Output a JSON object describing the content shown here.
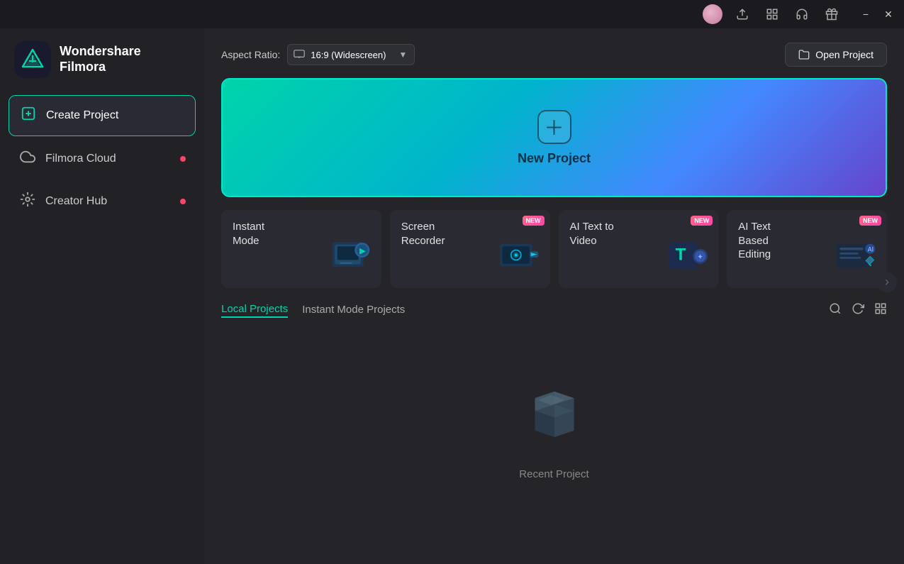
{
  "app": {
    "title": "Wondershare",
    "subtitle": "Filmora"
  },
  "titlebar": {
    "minimize_label": "−",
    "close_label": "✕"
  },
  "sidebar": {
    "items": [
      {
        "id": "create-project",
        "label": "Create Project",
        "icon": "＋",
        "active": true,
        "dot": false
      },
      {
        "id": "filmora-cloud",
        "label": "Filmora Cloud",
        "icon": "☁",
        "active": false,
        "dot": true
      },
      {
        "id": "creator-hub",
        "label": "Creator Hub",
        "icon": "💡",
        "active": false,
        "dot": true
      }
    ]
  },
  "toolbar": {
    "aspect_ratio_label": "Aspect Ratio:",
    "aspect_ratio_value": "16:9 (Widescreen)",
    "open_project_label": "Open Project"
  },
  "new_project": {
    "label": "New Project"
  },
  "mode_cards": [
    {
      "id": "instant-mode",
      "label": "Instant Mode",
      "badge": null
    },
    {
      "id": "screen-recorder",
      "label": "Screen Recorder",
      "badge": "NEW"
    },
    {
      "id": "ai-text-to-video",
      "label": "AI Text to Video",
      "badge": "NEW"
    },
    {
      "id": "ai-text-based-editing",
      "label": "AI Text Based Editing",
      "badge": "NEW"
    }
  ],
  "projects": {
    "tabs": [
      {
        "id": "local",
        "label": "Local Projects",
        "active": true
      },
      {
        "id": "instant",
        "label": "Instant Mode Projects",
        "active": false
      }
    ],
    "empty_label": "Recent Project"
  }
}
